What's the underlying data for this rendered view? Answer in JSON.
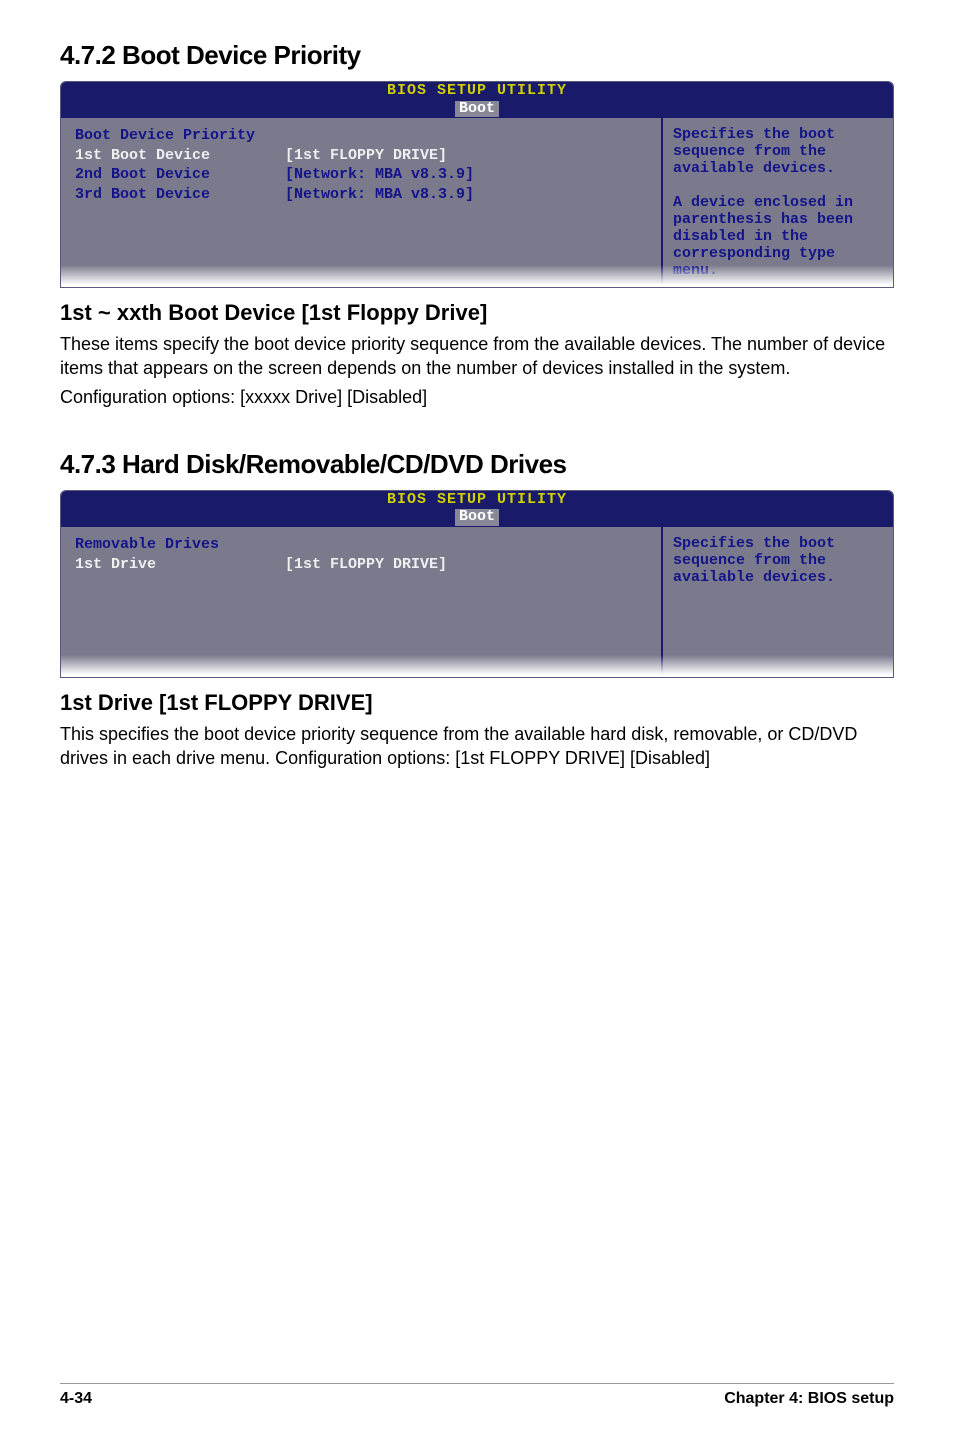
{
  "section_472": {
    "heading": "4.7.2   Boot Device Priority",
    "bios": {
      "header_title": "BIOS SETUP UTILITY",
      "header_tab": "Boot",
      "left_title": "Boot Device Priority",
      "rows": [
        {
          "label": "1st Boot Device",
          "value": "[1st FLOPPY DRIVE]",
          "style": "white"
        },
        {
          "label": "2nd Boot Device",
          "value": "[Network: MBA v8.3.9]",
          "style": "blue"
        },
        {
          "label": "3rd Boot Device",
          "value": "[Network: MBA v8.3.9]",
          "style": "blue"
        }
      ],
      "help": "Specifies the boot sequence from the available devices.\n\nA device enclosed in parenthesis has been disabled in the corresponding type menu."
    },
    "sub_heading": "1st ~ xxth Boot Device [1st Floppy Drive]",
    "body1": "These items specify the boot device priority sequence from the available devices. The number of device items that appears on the screen depends on the number of devices installed in the system.",
    "body2": "Configuration options: [xxxxx Drive] [Disabled]"
  },
  "section_473": {
    "heading": "4.7.3   Hard Disk/Removable/CD/DVD Drives",
    "bios": {
      "header_title": "BIOS SETUP UTILITY",
      "header_tab": "Boot",
      "left_title": "Removable Drives",
      "rows": [
        {
          "label": "1st Drive",
          "value": "[1st FLOPPY DRIVE]",
          "style": "white"
        }
      ],
      "help": "Specifies the boot sequence from the available devices."
    },
    "sub_heading": "1st Drive [1st FLOPPY DRIVE]",
    "body1": "This specifies the boot device priority sequence from the available hard disk, removable, or CD/DVD drives in each drive menu. Configuration options: [1st FLOPPY DRIVE] [Disabled]"
  },
  "footer": {
    "page": "4-34",
    "chapter": "Chapter 4: BIOS setup"
  }
}
